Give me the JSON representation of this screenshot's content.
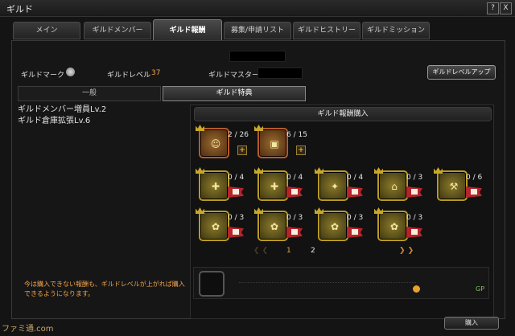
{
  "window": {
    "title": "ギルド",
    "help_label": "?",
    "close_label": "X"
  },
  "tabs": [
    {
      "label": "メイン"
    },
    {
      "label": "ギルドメンバー"
    },
    {
      "label": "ギルド報酬"
    },
    {
      "label": "募集/申請リスト"
    },
    {
      "label": "ギルドヒストリー"
    },
    {
      "label": "ギルドミッション"
    }
  ],
  "active_tab": "ギルド報酬",
  "guild_info": {
    "mark_label": "ギルドマーク",
    "level_label": "ギルドレベル",
    "level_value": "37",
    "master_label": "ギルドマスター",
    "level_up_button": "ギルドレベルアップ"
  },
  "subtabs": [
    {
      "label": "一般"
    },
    {
      "label": "ギルド特典"
    }
  ],
  "perks": [
    "ギルドメンバー増員Lv.2",
    "ギルド倉庫拡張Lv.6"
  ],
  "note": "今は購入できない報酬も、ギルドレベルが上がれば購入できるようになります。",
  "purchase": {
    "header": "ギルド報酬購入",
    "items": [
      {
        "name": "member-slot-reward",
        "icon": "user-plus-icon",
        "glyph": "☺",
        "count": "2 / 26",
        "kind": "plus"
      },
      {
        "name": "warehouse-reward",
        "icon": "box-icon",
        "glyph": "▣",
        "count": "6 / 15",
        "kind": "plus"
      },
      {
        "name": "exp-reward-1",
        "icon": "exp-icon",
        "glyph": "✚",
        "count": "0 / 4",
        "kind": "flag"
      },
      {
        "name": "exp-reward-2",
        "icon": "exp-icon",
        "glyph": "✚",
        "count": "0 / 4",
        "kind": "flag"
      },
      {
        "name": "sparkle-reward",
        "icon": "sparkle-icon",
        "glyph": "✦",
        "count": "0 / 4",
        "kind": "flag"
      },
      {
        "name": "building-reward",
        "icon": "building-icon",
        "glyph": "⌂",
        "count": "0 / 3",
        "kind": "flag"
      },
      {
        "name": "hammer-reward",
        "icon": "hammer-icon",
        "glyph": "⚒",
        "count": "0 / 6",
        "kind": "flag"
      },
      {
        "name": "leaf-reward",
        "icon": "leaf-icon",
        "glyph": "✿",
        "count": "0 / 3",
        "kind": "flag"
      },
      {
        "name": "leaf-reward-2",
        "icon": "leaf-icon",
        "glyph": "✿",
        "count": "0 / 3",
        "kind": "flag"
      },
      {
        "name": "leaf-reward-3",
        "icon": "leaf-icon",
        "glyph": "✿",
        "count": "0 / 3",
        "kind": "flag"
      },
      {
        "name": "leaf-reward-4",
        "icon": "leaf-icon",
        "glyph": "✿",
        "count": "0 / 3",
        "kind": "flag"
      }
    ],
    "pages": [
      "1",
      "2"
    ],
    "current_page": "1",
    "currency": "GP",
    "buy_button": "購入"
  },
  "watermark": "ファミ通.com"
}
